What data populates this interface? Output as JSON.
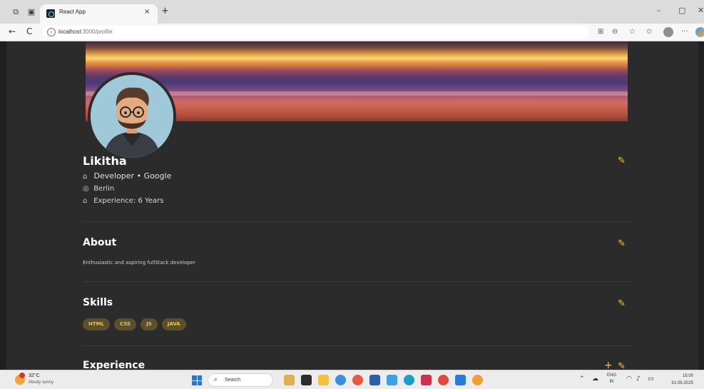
{
  "browser": {
    "tab_title": "React App",
    "tab_close": "×",
    "new_tab": "+",
    "url_host": "localhost",
    "url_path": ":3000/profile",
    "win_min": "–",
    "win_max": "▢",
    "win_close": "✕",
    "back": "←",
    "refresh": "C",
    "more": "···"
  },
  "profile": {
    "name": "Likitha",
    "role_line": "Developer • Google",
    "location": "Berlin",
    "experience_line": "Experience: 6 Years"
  },
  "about": {
    "heading": "About",
    "text": "Enthusiastic and aspiring fullStack developer"
  },
  "skills": {
    "heading": "Skills",
    "items": [
      "HTML",
      "CSS",
      "JS",
      "JAVA"
    ]
  },
  "experience": {
    "heading": "Experience",
    "add": "+"
  },
  "icons": {
    "edit": "✎",
    "briefcase": "⌂",
    "location": "◎"
  },
  "colors": {
    "accent": "#f2c53d",
    "page_bg": "#2b2b2b",
    "chip_bg": "#5a4f2f"
  },
  "taskbar": {
    "temp": "32°C",
    "weather": "Mostly sunny",
    "search_label": "Search",
    "lang_1": "ENG",
    "lang_2": "IN",
    "time": "15:00",
    "date": "31-05-2025"
  }
}
